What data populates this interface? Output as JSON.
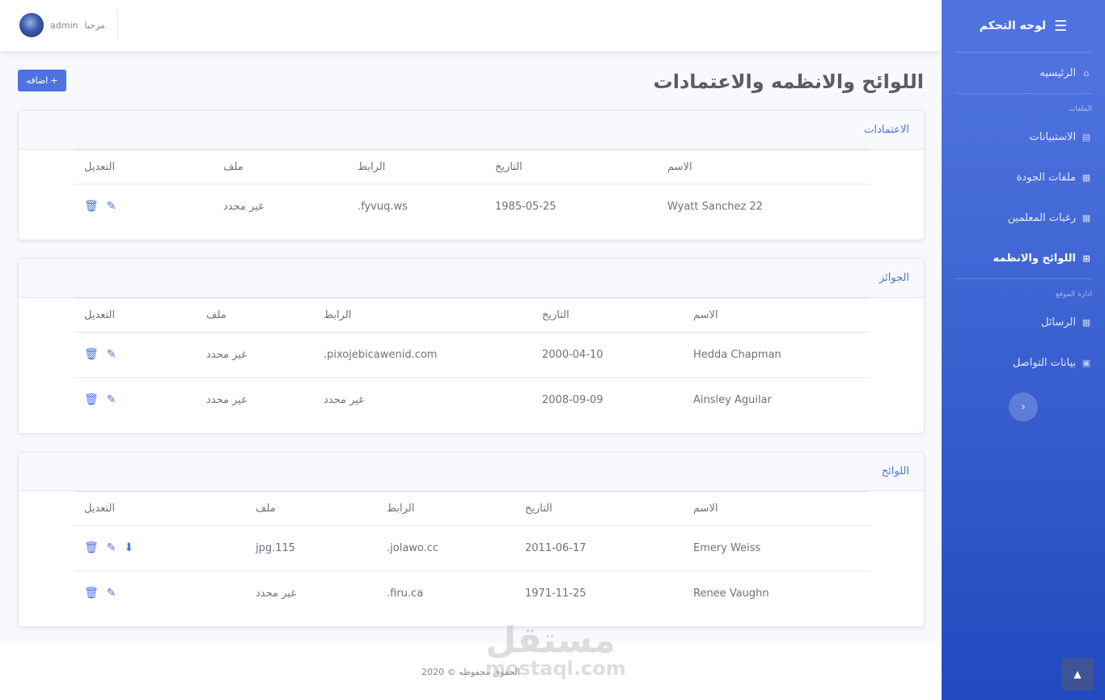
{
  "sidebar": {
    "brand": "لوحه التحكم",
    "brand_icon": "sliders-icon",
    "home_label": "الرئيسيه",
    "files_heading": "الملفات",
    "items": [
      {
        "label": "الاستبيانات",
        "icon": "list-icon",
        "active": false
      },
      {
        "label": "ملفات الجودة",
        "icon": "grid-icon",
        "active": false
      },
      {
        "label": "رغبات المعلمين",
        "icon": "grid-icon",
        "active": false
      },
      {
        "label": "اللوائح والانظمه",
        "icon": "table-icon",
        "active": true
      }
    ],
    "site_heading": "ادارة الموقع",
    "site_items": [
      {
        "label": "الرسائل",
        "icon": "grid-icon"
      },
      {
        "label": "بيانات التواصل",
        "icon": "id-card-icon"
      }
    ]
  },
  "topbar": {
    "user_name": "admin",
    "greeting": "مرحبا"
  },
  "page": {
    "title": "اللوائح والانظمه والاعتمادات",
    "add_label": "اضافه"
  },
  "table_headers": {
    "name": "الاسم",
    "date": "التاريخ",
    "link": "الرابط",
    "file": "ملف",
    "edit": "التعديل"
  },
  "sections": [
    {
      "title": "الاعتمادات",
      "rows": [
        {
          "name": "Wyatt Sanchez 22",
          "date": "1985-05-25",
          "link": "fyvuq.ws.",
          "file": "غير محدد",
          "download": false
        }
      ]
    },
    {
      "title": "الجوائز",
      "rows": [
        {
          "name": "Hedda Chapman",
          "date": "2000-04-10",
          "link": "pixojebicawenid.com.",
          "file": "غير محدد",
          "download": false
        },
        {
          "name": "Ainsley Aguilar",
          "date": "2008-09-09",
          "link": "غير محدد",
          "file": "غير محدد",
          "download": false
        }
      ]
    },
    {
      "title": "اللوائح",
      "rows": [
        {
          "name": "Emery Weiss",
          "date": "2011-06-17",
          "link": "jolawo.cc.",
          "file": "jpg.115",
          "download": true
        },
        {
          "name": "Renee Vaughn",
          "date": "1971-11-25",
          "link": "firu.ca.",
          "file": "غير محدد",
          "download": false
        }
      ]
    }
  ],
  "footer": {
    "text": "الحقوق محفوظه © 2020"
  },
  "watermark": {
    "arabic": "مستقل",
    "latin": "mostaql.com"
  },
  "colors": {
    "primary": "#4e73df",
    "sidebar_dark": "#224abe"
  }
}
